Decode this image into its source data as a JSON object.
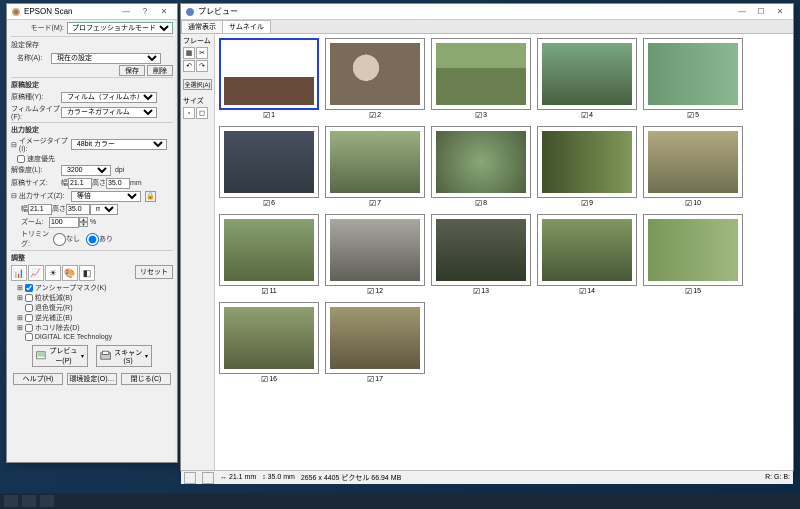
{
  "main_window": {
    "title": "EPSON Scan",
    "mode_label": "モード(M):",
    "mode_value": "プロフェッショナルモード",
    "settings_save": {
      "title": "設定保存",
      "name_label": "名称(A):",
      "name_value": "現在の設定",
      "save_btn": "保存",
      "delete_btn": "削除"
    },
    "original": {
      "title": "原稿設定",
      "type_label": "原稿種(Y):",
      "type_value": "フィルム（フィルムホルダー使用）",
      "film_label": "フィルムタイプ(F):",
      "film_value": "カラーネガフィルム"
    },
    "output": {
      "title": "出力設定",
      "image_type_label": "イメージタイプ(I):",
      "image_type_value": "48bit カラー",
      "speed_priority": "速度優先",
      "resolution_label": "解像度(L):",
      "resolution_value": "3200",
      "resolution_unit": "dpi",
      "original_size_label": "原稿サイズ:",
      "width_lbl": "幅",
      "width_val": "21.1",
      "height_lbl": "高さ",
      "height_val": "35.0",
      "unit": "mm",
      "output_size_label": "出力サイズ(Z):",
      "output_size_value": "等倍",
      "out_width_lbl": "幅",
      "out_width_val": "21.1",
      "out_height_lbl": "高さ",
      "out_height_val": "35.0",
      "out_unit": "mm",
      "zoom_label": "ズーム:",
      "zoom_value": "100",
      "zoom_unit": "%",
      "trimming_label": "トリミング:",
      "trimming_none": "なし",
      "trimming_yes": "あり"
    },
    "adjust": {
      "title": "調整",
      "reset": "リセット",
      "items": [
        {
          "label": "アンシャープマスク(K)",
          "checked": true,
          "expandable": true
        },
        {
          "label": "粒状低減(B)",
          "checked": false,
          "expandable": true
        },
        {
          "label": "退色復元(R)",
          "checked": false,
          "expandable": false
        },
        {
          "label": "逆光補正(B)",
          "checked": false,
          "expandable": true
        },
        {
          "label": "ホコリ除去(D)",
          "checked": false,
          "expandable": true
        },
        {
          "label": "DIGITAL ICE Technology",
          "checked": false,
          "expandable": false
        }
      ]
    },
    "preview_btn": "プレビュー(P)",
    "scan_btn": "スキャン(S)",
    "help_btn": "ヘルプ(H)",
    "env_btn": "環境設定(O)…",
    "close_btn": "閉じる(C)"
  },
  "preview_window": {
    "title": "プレビュー",
    "tabs": {
      "normal": "通常表示",
      "thumb": "サムネイル"
    },
    "frame_panel": {
      "title": "フレーム",
      "select_all": "全選択(A)",
      "size_title": "サイズ"
    },
    "thumbnails": [
      1,
      2,
      3,
      4,
      5,
      6,
      7,
      8,
      9,
      10,
      11,
      12,
      13,
      14,
      15,
      16,
      17
    ],
    "status": {
      "dim1": "21.1 mm",
      "dim2": "35.0 mm",
      "info": "2656 x 4405 ピクセル 66.94 MB",
      "rgb": "R: G: B:"
    }
  }
}
